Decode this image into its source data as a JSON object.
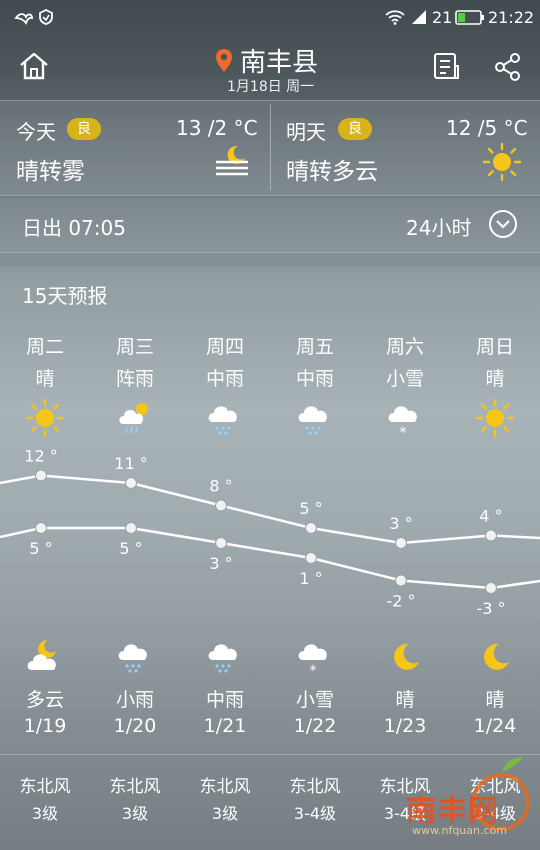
{
  "status": {
    "signal_label": "21",
    "time": "21:22"
  },
  "header": {
    "city": "南丰县",
    "date": "1月18日 周一"
  },
  "today": {
    "label": "今天",
    "aqi": "良",
    "temp": "13 /2 °C",
    "desc": "晴转雾"
  },
  "tomorrow": {
    "label": "明天",
    "aqi": "良",
    "temp": "12 /5 °C",
    "desc": "晴转多云"
  },
  "sunrise": {
    "text": "日出 07:05",
    "hours_label": "24小时"
  },
  "forecast": {
    "title": "15天预报",
    "days": [
      {
        "day": "周二",
        "weather": "晴",
        "day_icon": "sun-icon",
        "high": "12 °",
        "low": "5 °",
        "night_icon": "partly-cloudy-night-icon",
        "night_weather": "多云",
        "date": "1/19",
        "wind": "东北风",
        "level": "3级"
      },
      {
        "day": "周三",
        "weather": "阵雨",
        "day_icon": "shower-icon",
        "high": "11 °",
        "low": "5 °",
        "night_icon": "rain-icon",
        "night_weather": "小雨",
        "date": "1/20",
        "wind": "东北风",
        "level": "3级"
      },
      {
        "day": "周四",
        "weather": "中雨",
        "day_icon": "rain-icon",
        "high": "8 °",
        "low": "3 °",
        "night_icon": "rain-icon",
        "night_weather": "中雨",
        "date": "1/21",
        "wind": "东北风",
        "level": "3级"
      },
      {
        "day": "周五",
        "weather": "中雨",
        "day_icon": "rain-icon",
        "high": "5 °",
        "low": "1 °",
        "night_icon": "snow-icon",
        "night_weather": "小雪",
        "date": "1/22",
        "wind": "东北风",
        "level": "3-4级"
      },
      {
        "day": "周六",
        "weather": "小雪",
        "day_icon": "snow-icon",
        "high": "3 °",
        "low": "-2 °",
        "night_icon": "moon-icon",
        "night_weather": "晴",
        "date": "1/23",
        "wind": "东北风",
        "level": "3-4级"
      },
      {
        "day": "周日",
        "weather": "晴",
        "day_icon": "sun-icon",
        "high": "4 °",
        "low": "-3 °",
        "night_icon": "moon-icon",
        "night_weather": "晴",
        "date": "1/24",
        "wind": "东北风",
        "level": "3-4级"
      }
    ],
    "high_values": [
      12,
      11,
      8,
      5,
      3,
      4
    ],
    "low_values": [
      5,
      5,
      3,
      1,
      -2,
      -3
    ]
  },
  "watermark": {
    "text": "南丰网",
    "url": "www.nfquan.com"
  },
  "colors": {
    "aqi": "#d8b41a",
    "sun": "#f5c518",
    "location_pin": "#ef6b2e"
  }
}
